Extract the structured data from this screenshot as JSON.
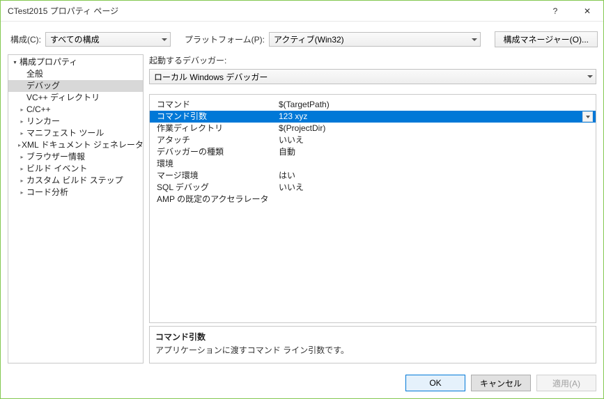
{
  "window": {
    "title": "CTest2015 プロパティ ページ",
    "help": "?",
    "close": "✕"
  },
  "top": {
    "config_label": "構成(C):",
    "config_value": "すべての構成",
    "platform_label": "プラットフォーム(P):",
    "platform_value": "アクティブ(Win32)",
    "manager_label": "構成マネージャー(O)..."
  },
  "tree": {
    "root": "構成プロパティ",
    "items": [
      {
        "label": "全般",
        "leaf": true
      },
      {
        "label": "デバッグ",
        "leaf": true,
        "selected": true
      },
      {
        "label": "VC++ ディレクトリ",
        "leaf": true
      },
      {
        "label": "C/C++",
        "leaf": false
      },
      {
        "label": "リンカー",
        "leaf": false
      },
      {
        "label": "マニフェスト ツール",
        "leaf": false
      },
      {
        "label": "XML ドキュメント ジェネレーター",
        "leaf": false
      },
      {
        "label": "ブラウザー情報",
        "leaf": false
      },
      {
        "label": "ビルド イベント",
        "leaf": false
      },
      {
        "label": "カスタム ビルド ステップ",
        "leaf": false
      },
      {
        "label": "コード分析",
        "leaf": false
      }
    ]
  },
  "debugger": {
    "label": "起動するデバッガー:",
    "value": "ローカル Windows デバッガー"
  },
  "grid": {
    "rows": [
      {
        "k": "コマンド",
        "v": "$(TargetPath)"
      },
      {
        "k": "コマンド引数",
        "v": "123 xyz",
        "selected": true
      },
      {
        "k": "作業ディレクトリ",
        "v": "$(ProjectDir)"
      },
      {
        "k": "アタッチ",
        "v": "いいえ"
      },
      {
        "k": "デバッガーの種類",
        "v": "自動"
      },
      {
        "k": "環境",
        "v": ""
      },
      {
        "k": "マージ環境",
        "v": "はい"
      },
      {
        "k": "SQL デバッグ",
        "v": "いいえ"
      },
      {
        "k": "AMP の既定のアクセラレータ",
        "v": ""
      }
    ]
  },
  "desc": {
    "title": "コマンド引数",
    "text": "アプリケーションに渡すコマンド ライン引数です。"
  },
  "footer": {
    "ok": "OK",
    "cancel": "キャンセル",
    "apply": "適用(A)"
  }
}
